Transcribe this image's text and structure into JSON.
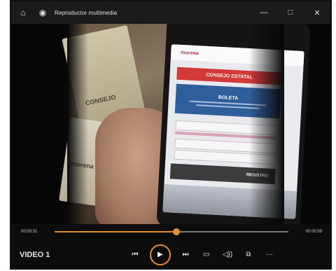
{
  "window": {
    "title": "Reproductor multimedia",
    "icons": {
      "home": "home-icon",
      "app": "media-player-icon"
    },
    "controls": {
      "minimize": "—",
      "maximize": "□",
      "close": "✕"
    }
  },
  "video": {
    "phone_screen": {
      "logo_left": "morena",
      "logo_right": "",
      "red_banner": "CONSEJO ESTATAL",
      "blue_banner_title": "BOLETA",
      "dark_button": "REGISTRO"
    },
    "bill_texts": [
      "CONSEJO",
      "morena"
    ]
  },
  "seek": {
    "current_time": "00:00:31",
    "total_time": "00:00:59",
    "progress": 0.52,
    "accent": "#e68a2e"
  },
  "controls": {
    "title": "VIDEO 1",
    "icons": [
      "previous-icon",
      "play-icon",
      "next-icon",
      "captions-icon",
      "volume-icon",
      "cast-icon",
      "more-icon"
    ]
  }
}
